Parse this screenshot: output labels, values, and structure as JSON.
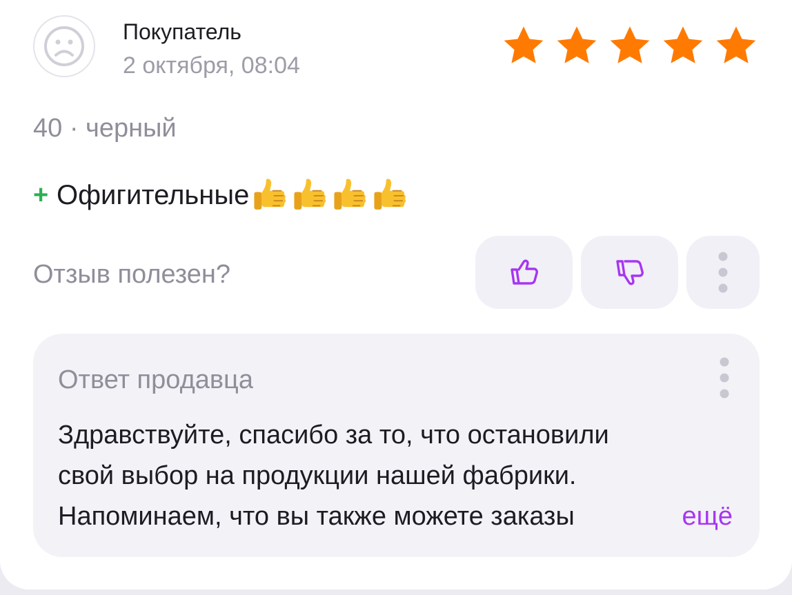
{
  "review": {
    "author": "Покупатель",
    "date": "2 октября, 08:04",
    "rating": 5,
    "rating_max": 5,
    "variant": "40 · черный",
    "pros_marker": "+",
    "pros_text": "Офигительные",
    "pros_emoji": [
      "thumbs-up-emoji",
      "thumbs-up-emoji",
      "thumbs-up-emoji",
      "thumbs-up-emoji"
    ],
    "helpful_question": "Отзыв полезен?"
  },
  "seller_reply": {
    "title": "Ответ продавца",
    "lines": [
      "Здравствуйте, спасибо за то, что остановили",
      "свой выбор на продукции нашей фабрики.",
      "Напоминаем, что вы также можете заказы"
    ],
    "more_label": "ещё"
  },
  "colors": {
    "star": "#ff7a00",
    "accent": "#a736f0",
    "pros_plus": "#2cb052",
    "muted_text": "#8f8e9a"
  },
  "icons": {
    "avatar": "user-avatar-icon",
    "like": "thumbs-up-icon",
    "dislike": "thumbs-down-icon",
    "more": "more-vertical-icon"
  }
}
